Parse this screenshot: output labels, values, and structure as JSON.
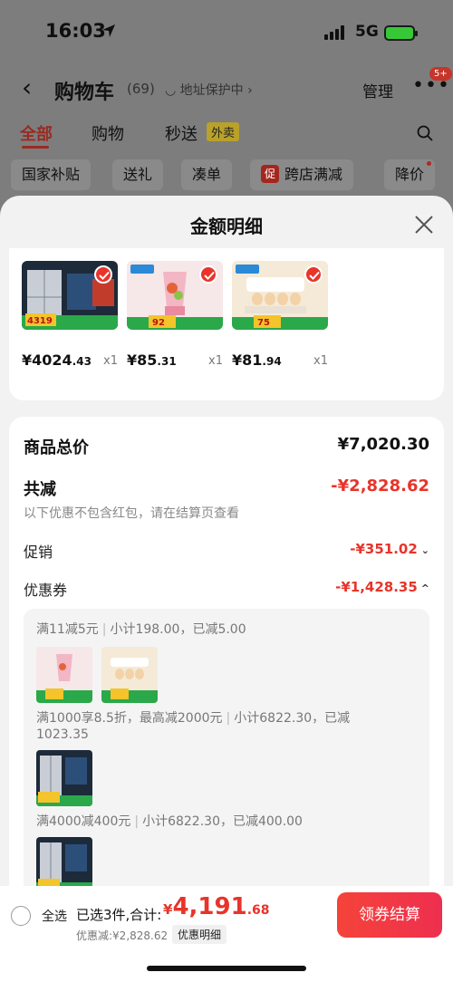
{
  "status": {
    "time": "16:03",
    "network": "5G"
  },
  "cart": {
    "back": "‹",
    "title": "购物车",
    "count": "(69)",
    "address": "◡ 地址保护中 ›",
    "manage": "管理",
    "more": "•••",
    "badge": "5+"
  },
  "tabs": [
    {
      "label": "全部",
      "active": true
    },
    {
      "label": "购物"
    },
    {
      "label": "秒送"
    },
    {
      "label": "外卖"
    }
  ],
  "chips": [
    "国家补贴",
    "送礼",
    "凑单",
    "跨店满减",
    "降价"
  ],
  "chip_tag": "促",
  "sheet": {
    "title": "金额明细"
  },
  "products": [
    {
      "price_int": "¥4024",
      "price_dec": ".43",
      "qty": "x1",
      "badge_text": "4319"
    },
    {
      "price_int": "¥85",
      "price_dec": ".31",
      "qty": "x1",
      "badge_text": "92"
    },
    {
      "price_int": "¥81",
      "price_dec": ".94",
      "qty": "x1",
      "badge_text": "75"
    }
  ],
  "detail": {
    "total_label": "商品总价",
    "total_value": "¥7,020.30",
    "reduce_label": "共减",
    "reduce_value": "-¥2,828.62",
    "note": "以下优惠不包含红包，请在结算页查看",
    "promo_label": "促销",
    "promo_value": "-¥351.02",
    "coupon_label": "优惠券",
    "coupon_value": "-¥1,428.35"
  },
  "coupons": [
    {
      "rule": "满11减5元",
      "sub": "小计198.00，已减5.00"
    },
    {
      "rule": "满1000享8.5折，最高减2000元",
      "sub": "小计6822.30，已减",
      "sub2": "1023.35"
    },
    {
      "rule": "满4000减400元",
      "sub": "小计6822.30，已减400.00"
    }
  ],
  "bottom": {
    "select_all": "全选",
    "selected": "已选3件,合计:",
    "cur": "¥",
    "total_int": "4,191",
    "total_dec": ".68",
    "discount": "优惠减:¥2,828.62",
    "detail_btn": "优惠明细",
    "pay": "领券结算"
  },
  "colors": {
    "accent": "#e8342a",
    "dim": "#7d7d7d",
    "sheet": "#f2f2f2"
  }
}
